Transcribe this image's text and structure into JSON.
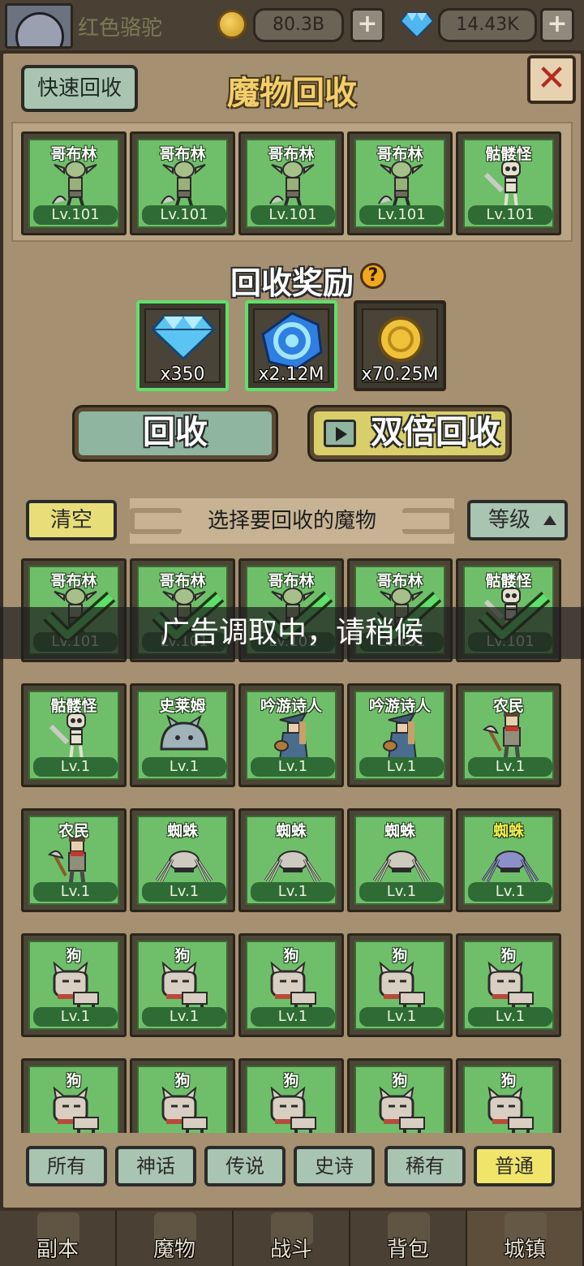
{
  "player": {
    "name": "红色骆驼"
  },
  "currency": {
    "gold": "80.3B",
    "gems": "14.43K",
    "plus": "+"
  },
  "panel": {
    "title": "魔物回收",
    "quick_recycle": "快速回收",
    "close": "✕"
  },
  "selected": [
    {
      "name": "哥布林",
      "level": "Lv.101",
      "art": "goblin"
    },
    {
      "name": "哥布林",
      "level": "Lv.101",
      "art": "goblin"
    },
    {
      "name": "哥布林",
      "level": "Lv.101",
      "art": "goblin"
    },
    {
      "name": "哥布林",
      "level": "Lv.101",
      "art": "goblin"
    },
    {
      "name": "骷髅怪",
      "level": "Lv.101",
      "art": "skeleton"
    }
  ],
  "reward": {
    "title": "回收奖励",
    "help": "?",
    "items": [
      {
        "icon": "diamond-icon",
        "amount": "x350",
        "highlight": true
      },
      {
        "icon": "blue-orb-icon",
        "amount": "x2.12M",
        "highlight": true
      },
      {
        "icon": "gold-coin-icon",
        "amount": "x70.25M",
        "highlight": false
      }
    ]
  },
  "actions": {
    "recycle": "回收",
    "double_recycle": "双倍回收"
  },
  "selector": {
    "clear": "清空",
    "hint": "选择要回收的魔物",
    "sort": "等级"
  },
  "monsters": [
    {
      "name": "哥布林",
      "level": "Lv.101",
      "art": "goblin",
      "checked": true
    },
    {
      "name": "哥布林",
      "level": "Lv.101",
      "art": "goblin",
      "checked": true
    },
    {
      "name": "哥布林",
      "level": "Lv.101",
      "art": "goblin",
      "checked": true
    },
    {
      "name": "哥布林",
      "level": "Lv.101",
      "art": "goblin",
      "checked": true
    },
    {
      "name": "骷髅怪",
      "level": "Lv.101",
      "art": "skeleton",
      "checked": true
    },
    {
      "name": "骷髅怪",
      "level": "Lv.1",
      "art": "skeleton"
    },
    {
      "name": "史莱姆",
      "level": "Lv.1",
      "art": "slime"
    },
    {
      "name": "吟游诗人",
      "level": "Lv.1",
      "art": "bard"
    },
    {
      "name": "吟游诗人",
      "level": "Lv.1",
      "art": "bard"
    },
    {
      "name": "农民",
      "level": "Lv.1",
      "art": "farmer"
    },
    {
      "name": "农民",
      "level": "Lv.1",
      "art": "farmer"
    },
    {
      "name": "蜘蛛",
      "level": "Lv.1",
      "art": "spider"
    },
    {
      "name": "蜘蛛",
      "level": "Lv.1",
      "art": "spider"
    },
    {
      "name": "蜘蛛",
      "level": "Lv.1",
      "art": "spider"
    },
    {
      "name": "蜘蛛",
      "level": "Lv.1",
      "art": "spider-blue",
      "gold": true
    },
    {
      "name": "狗",
      "level": "Lv.1",
      "art": "dog"
    },
    {
      "name": "狗",
      "level": "Lv.1",
      "art": "dog"
    },
    {
      "name": "狗",
      "level": "Lv.1",
      "art": "dog"
    },
    {
      "name": "狗",
      "level": "Lv.1",
      "art": "dog"
    },
    {
      "name": "狗",
      "level": "Lv.1",
      "art": "dog"
    },
    {
      "name": "狗",
      "level": "",
      "art": "dog"
    },
    {
      "name": "狗",
      "level": "",
      "art": "dog"
    },
    {
      "name": "狗",
      "level": "",
      "art": "dog"
    },
    {
      "name": "狗",
      "level": "",
      "art": "dog"
    },
    {
      "name": "狗",
      "level": "",
      "art": "dog"
    }
  ],
  "overlay": "广告调取中，请稍候",
  "filters": [
    "所有",
    "神话",
    "传说",
    "史诗",
    "稀有",
    "普通"
  ],
  "active_filter": "普通",
  "nav": [
    "副本",
    "魔物",
    "战斗",
    "背包",
    "城镇"
  ],
  "active_nav": "城镇",
  "colors": {
    "card_green": "#6fbf6a",
    "gold_text": "#f3ec4a",
    "accent_yellow": "#f0e46a"
  }
}
